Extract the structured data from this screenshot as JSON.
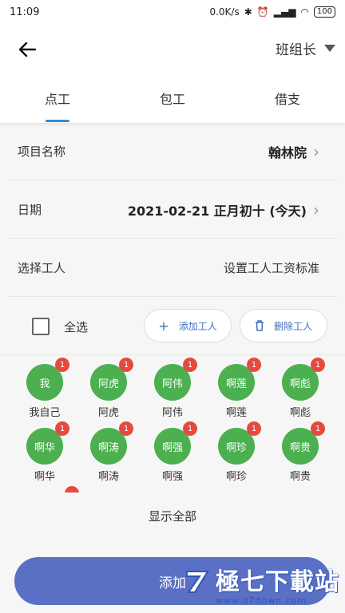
{
  "status": {
    "time": "11:09",
    "speed": "0.0K/s",
    "battery": "100"
  },
  "header": {
    "role": "班组长"
  },
  "tabs": [
    {
      "label": "点工"
    },
    {
      "label": "包工"
    },
    {
      "label": "借支"
    }
  ],
  "form": {
    "project_label": "项目名称",
    "project_value": "翰林院",
    "date_label": "日期",
    "date_value": "2021-02-21 正月初十 (今天)",
    "workers_label": "选择工人",
    "wage_standard": "设置工人工资标准"
  },
  "selection": {
    "select_all": "全选",
    "add_worker": "添加工人",
    "remove_worker": "删除工人"
  },
  "workers": [
    {
      "avatar": "我",
      "name": "我自己",
      "badge": "1"
    },
    {
      "avatar": "阿虎",
      "name": "阿虎",
      "badge": "1"
    },
    {
      "avatar": "阿伟",
      "name": "阿伟",
      "badge": "1"
    },
    {
      "avatar": "啊莲",
      "name": "啊莲",
      "badge": "1"
    },
    {
      "avatar": "啊彪",
      "name": "啊彪",
      "badge": "1"
    },
    {
      "avatar": "啊华",
      "name": "啊华",
      "badge": "1"
    },
    {
      "avatar": "啊涛",
      "name": "啊涛",
      "badge": "1"
    },
    {
      "avatar": "啊强",
      "name": "啊强",
      "badge": "1"
    },
    {
      "avatar": "啊珍",
      "name": "啊珍",
      "badge": "1"
    },
    {
      "avatar": "啊贵",
      "name": "啊贵",
      "badge": "1"
    }
  ],
  "show_all": "显示全部",
  "submit": "添加",
  "watermark": {
    "brand": "極七下載站",
    "url": "www.d7down.com"
  },
  "colors": {
    "accent": "#2b8fd6",
    "avatar": "#4caf50",
    "badge": "#e64a3d",
    "button": "#5a70c4"
  },
  "icons": [
    "back-arrow-icon",
    "dropdown-triangle-icon",
    "chevron-right-icon",
    "plus-icon",
    "trash-icon"
  ]
}
